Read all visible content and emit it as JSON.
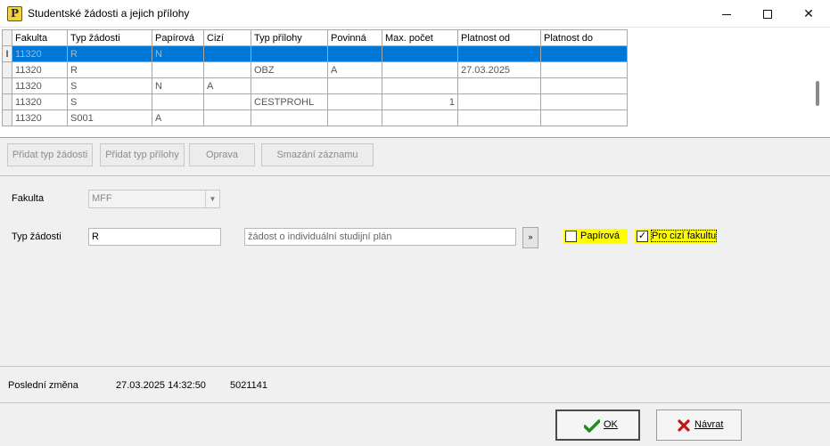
{
  "window": {
    "title": "Studentské žádosti a jejich přílohy",
    "icon": "app-yellow-note-icon"
  },
  "grid": {
    "columns": [
      "Fakulta",
      "Typ žádosti",
      "Papírová",
      "Cizí",
      "Typ přílohy",
      "Povinná",
      "Max. počet",
      "Platnost od",
      "Platnost do"
    ],
    "rows": [
      {
        "indicator": "I",
        "selected": true,
        "cells": [
          "11320",
          "R",
          "N",
          "",
          "",
          "",
          "",
          "",
          ""
        ]
      },
      {
        "indicator": "",
        "selected": false,
        "cells": [
          "11320",
          "R",
          "",
          "",
          "OBZ",
          "A",
          "",
          "27.03.2025",
          ""
        ]
      },
      {
        "indicator": "",
        "selected": false,
        "cells": [
          "11320",
          "S",
          "N",
          "A",
          "",
          "",
          "",
          "",
          ""
        ]
      },
      {
        "indicator": "",
        "selected": false,
        "cells": [
          "11320",
          "S",
          "",
          "",
          "CESTPROHL",
          "",
          "1",
          "",
          ""
        ]
      },
      {
        "indicator": "",
        "selected": false,
        "cells": [
          "11320",
          "S001",
          "A",
          "",
          "",
          "",
          "",
          "",
          ""
        ]
      }
    ]
  },
  "toolbar": {
    "add_request_type": "Přidat typ žádosti",
    "add_attachment_type": "Přidat typ přílohy",
    "edit": "Oprava",
    "delete_record": "Smazání záznamu"
  },
  "form": {
    "fakulta_label": "Fakulta",
    "fakulta_value": "MFF",
    "typ_zadosti_label": "Typ žádosti",
    "typ_zadosti_value": "R",
    "typ_zadosti_description": "žádost o individuální studijní plán",
    "lookup_button": "»",
    "papirova_label": "Papírová",
    "papirova_checked": false,
    "cizi_label": "Pro cizí fakultu",
    "cizi_checked": true
  },
  "status": {
    "last_change_label": "Poslední změna",
    "last_change_timestamp": "27.03.2025 14:32:50",
    "last_change_user": "5021141"
  },
  "buttons": {
    "ok_label": "OK",
    "cancel_label": "Návrat"
  },
  "colors": {
    "selection": "#0078d7",
    "highlight": "#ffff00",
    "ok_icon": "#1e8f1e",
    "cancel_icon": "#c01818"
  }
}
